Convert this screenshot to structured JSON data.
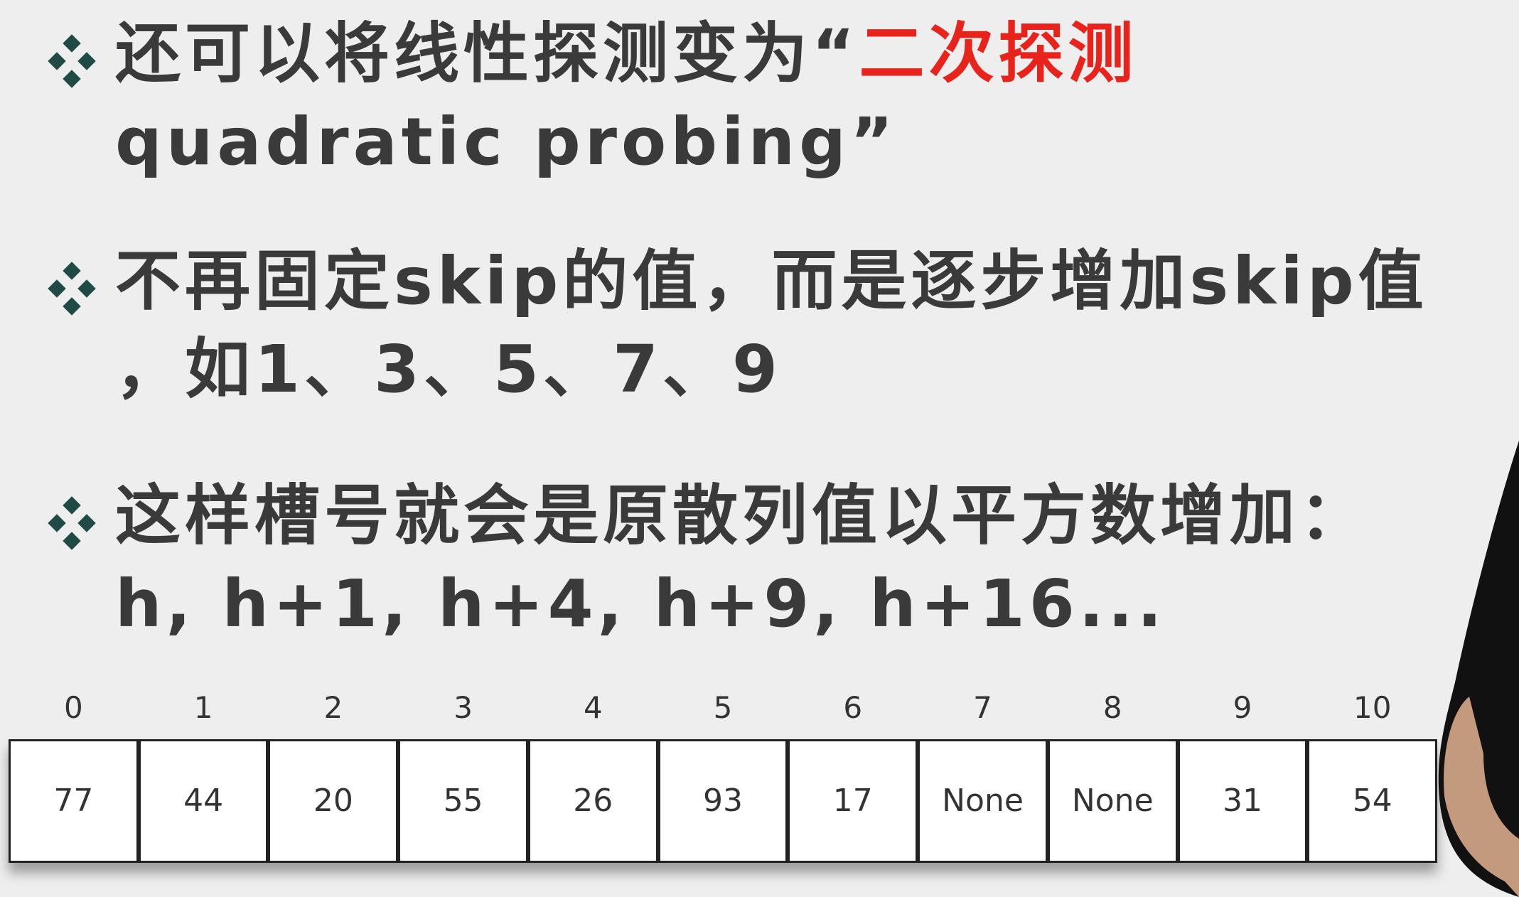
{
  "bullets": [
    {
      "lines": [
        {
          "plain": "还可以将线性探测变为“",
          "highlight": "二次探测"
        },
        {
          "plain": "quadratic probing”"
        }
      ]
    },
    {
      "lines": [
        {
          "plain": "不再固定skip的值，而是逐步增加skip值"
        },
        {
          "plain": "，如1、3、5、7、9"
        }
      ]
    },
    {
      "lines": [
        {
          "plain": "这样槽号就会是原散列值以平方数增加："
        },
        {
          "plain": "h, h+1, h+4, h+9, h+16..."
        }
      ]
    }
  ],
  "hash_table": {
    "indices": [
      "0",
      "1",
      "2",
      "3",
      "4",
      "5",
      "6",
      "7",
      "8",
      "9",
      "10"
    ],
    "values": [
      "77",
      "44",
      "20",
      "55",
      "26",
      "93",
      "17",
      "None",
      "None",
      "31",
      "54"
    ]
  },
  "colors": {
    "text": "#3a3a3a",
    "highlight": "#e8231c",
    "marker": "#1f4a45",
    "background": "#eeeeee"
  }
}
